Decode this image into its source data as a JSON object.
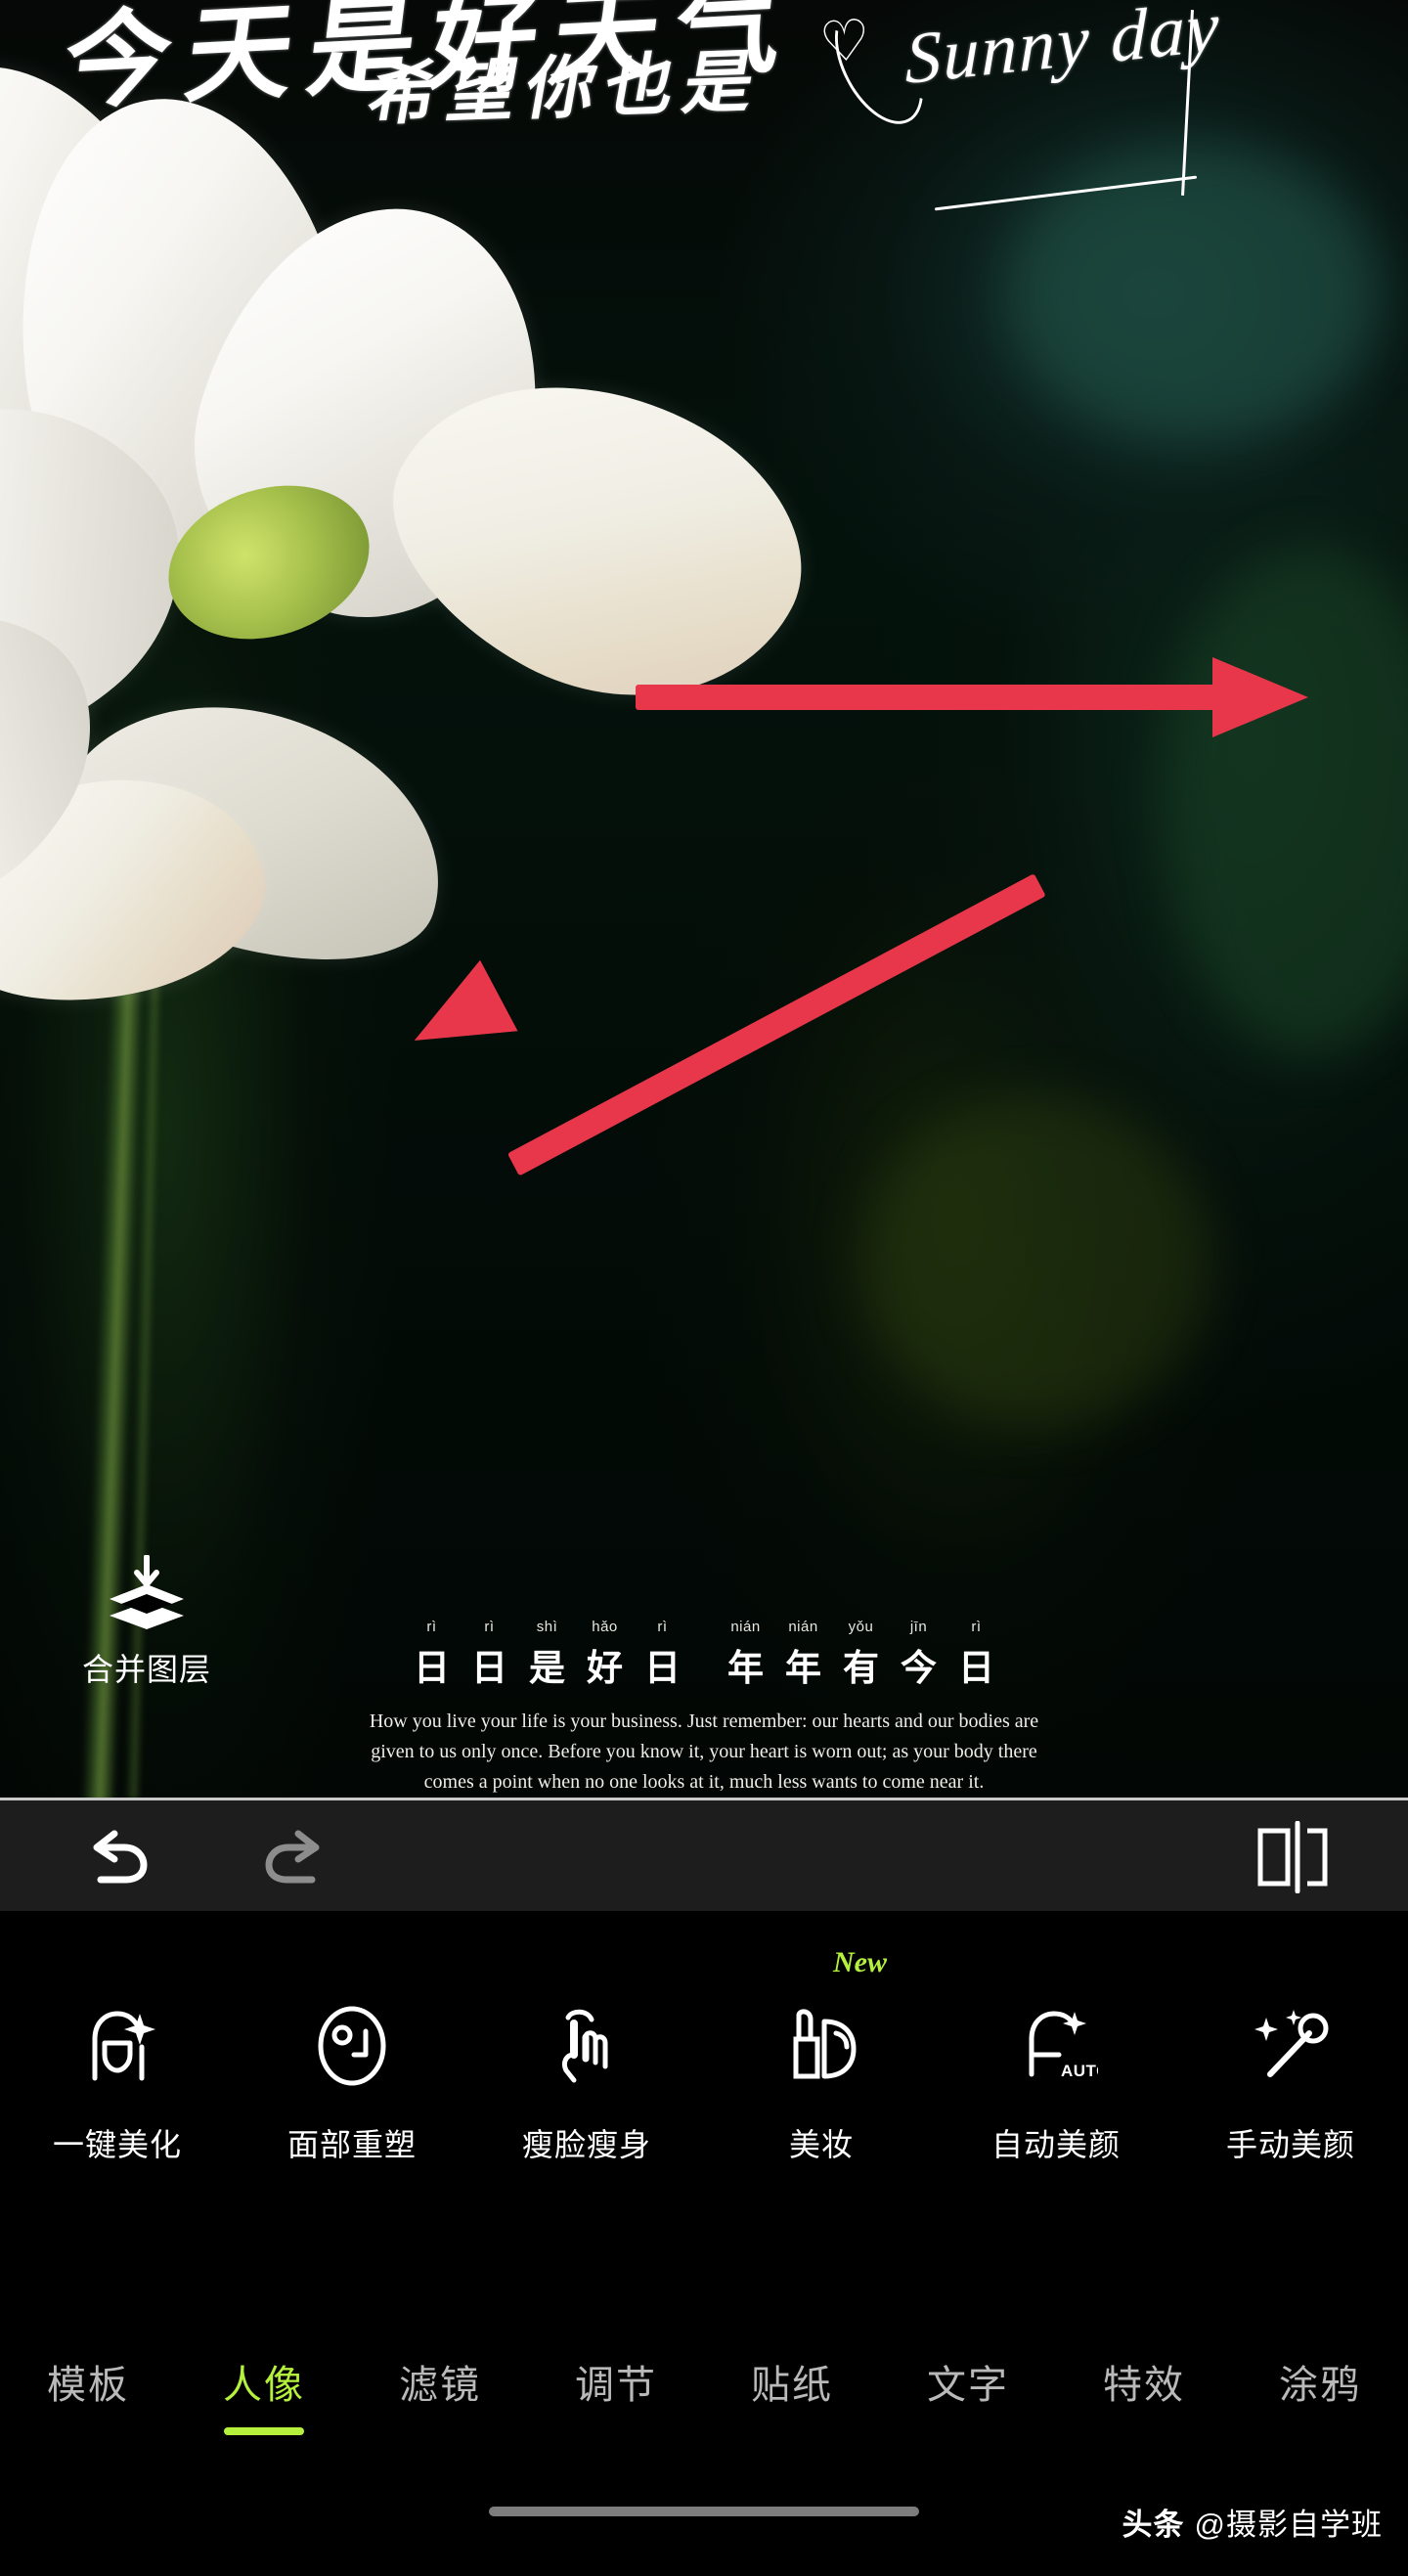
{
  "app": {
    "overlay_handwriting": {
      "line1": "今天是好天气",
      "line2": "希望你也是",
      "script_text": "Sunny day",
      "heart_icon": "heart-icon"
    },
    "poem": {
      "characters": [
        {
          "hanzi": "日",
          "pinyin": "rì"
        },
        {
          "hanzi": "日",
          "pinyin": "rì"
        },
        {
          "hanzi": "是",
          "pinyin": "shì"
        },
        {
          "hanzi": "好",
          "pinyin": "hǎo"
        },
        {
          "hanzi": "日",
          "pinyin": "rì"
        }
      ],
      "characters2": [
        {
          "hanzi": "年",
          "pinyin": "nián"
        },
        {
          "hanzi": "年",
          "pinyin": "nián"
        },
        {
          "hanzi": "有",
          "pinyin": "yǒu"
        },
        {
          "hanzi": "今",
          "pinyin": "jīn"
        },
        {
          "hanzi": "日",
          "pinyin": "rì"
        }
      ],
      "english": "How you live your life is your business. Just remember: our hearts and our bodies are given to us only once. Before you know it, your heart is worn out; as your body there comes a point when no one looks at it, much less wants to come near it."
    },
    "merge_layers": {
      "label": "合并图层",
      "icon": "merge-layers-icon"
    },
    "edit_bar": {
      "undo": {
        "label": "撤销",
        "icon": "undo-arrow-icon"
      },
      "redo": {
        "label": "重做",
        "icon": "redo-arrow-icon"
      },
      "compare": {
        "label": "对比",
        "icon": "compare-split-icon"
      }
    },
    "tools": [
      {
        "label": "一键美化",
        "icon": "one-tap-beautify-icon",
        "badge": ""
      },
      {
        "label": "面部重塑",
        "icon": "face-reshape-icon",
        "badge": ""
      },
      {
        "label": "瘦脸瘦身",
        "icon": "slim-face-body-icon",
        "badge": ""
      },
      {
        "label": "美妆",
        "icon": "makeup-lipstick-icon",
        "badge": "New"
      },
      {
        "label": "自动美颜",
        "icon": "auto-beauty-icon",
        "badge": ""
      },
      {
        "label": "手动美颜",
        "icon": "manual-beauty-icon",
        "badge": ""
      }
    ],
    "tabs": [
      {
        "label": "模板",
        "active": false
      },
      {
        "label": "人像",
        "active": true
      },
      {
        "label": "滤镜",
        "active": false
      },
      {
        "label": "调节",
        "active": false
      },
      {
        "label": "贴纸",
        "active": false
      },
      {
        "label": "文字",
        "active": false
      },
      {
        "label": "特效",
        "active": false
      },
      {
        "label": "涂鸦",
        "active": false
      }
    ],
    "watermark": {
      "logo": "头条",
      "text": "@摄影自学班"
    },
    "annotations": {
      "arrow_color": "#e8374a",
      "arrow_count": 2
    },
    "colors": {
      "accent_green": "#b4f03c",
      "inactive_gray": "#b9b9b9",
      "editbar_bg": "#1d1d1d",
      "canvas_bg": "#000000"
    }
  }
}
